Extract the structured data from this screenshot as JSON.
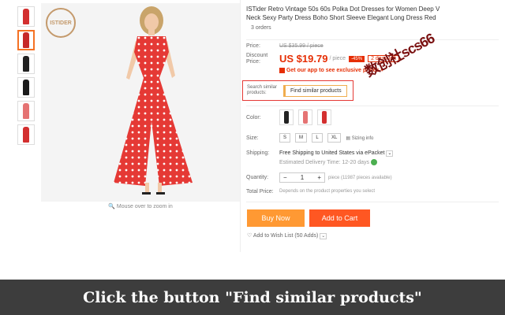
{
  "product": {
    "title": "ISTider Retro Vintage 50s 60s Polka Dot Dresses for Women Deep V Neck Sexy Party Dress Boho Short Sleeve Elegant Long Dress Red",
    "orders": "3 orders",
    "brand": "ISTIDER"
  },
  "gallery": {
    "zoom_hint": "Mouse over to zoom in",
    "thumbnail_colors": [
      "#d32f2f",
      "#c62828",
      "#212121",
      "#1b1b1b",
      "#e57373",
      "#d32f2f"
    ]
  },
  "pricing": {
    "price_label": "Price:",
    "original": "US $35.99 / piece",
    "discount_label": "Discount Price:",
    "discounted": "US $19.79",
    "per_piece": "/ piece",
    "badge": "-45%",
    "days_left": "2 days left",
    "app_promo": "Get our app to see exclusive prices"
  },
  "similar": {
    "label": "Search similar products:",
    "button": "Find similar products"
  },
  "watermark": "数创社scs66",
  "color": {
    "label": "Color:",
    "swatches": [
      "#222222",
      "#e57373",
      "#d32f2f"
    ]
  },
  "size": {
    "label": "Size:",
    "options": [
      "M",
      "L",
      "XL"
    ],
    "first_option": "S",
    "sizing_info": "Sizing info"
  },
  "shipping": {
    "label": "Shipping:",
    "main": "Free Shipping to United States via ePacket",
    "estimate": "Estimated Delivery Time: 12-20 days"
  },
  "quantity": {
    "label": "Quantity:",
    "value": "1",
    "info": "piece (11987 pieces available)"
  },
  "total": {
    "label": "Total Price:",
    "value": "Depends on the product properties you select"
  },
  "actions": {
    "buy_now": "Buy Now",
    "add_to_cart": "Add to Cart",
    "wish_list": "Add to Wish List (50 Adds)"
  },
  "instruction": "Click the button \"Find similar products\"",
  "colors": {
    "accent_red": "#e62e04",
    "buy_orange": "#ff9933",
    "cart_orange": "#ff5722",
    "highlight_border": "#e53935"
  }
}
